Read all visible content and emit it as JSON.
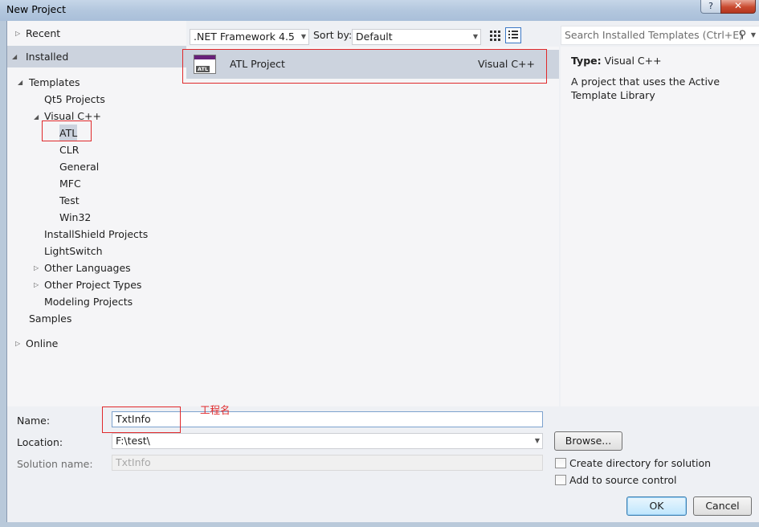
{
  "window": {
    "title": "New Project",
    "help_glyph": "?",
    "close_glyph": "✕"
  },
  "tree": {
    "recent": "Recent",
    "installed": "Installed",
    "templates": "Templates",
    "qt5": "Qt5 Projects",
    "visual_cpp": "Visual C++",
    "atl": "ATL",
    "clr": "CLR",
    "general": "General",
    "mfc": "MFC",
    "test": "Test",
    "win32": "Win32",
    "installshield": "InstallShield Projects",
    "lightswitch": "LightSwitch",
    "other_languages": "Other Languages",
    "other_project_types": "Other Project Types",
    "modeling": "Modeling Projects",
    "samples": "Samples",
    "online": "Online"
  },
  "toolbar": {
    "framework": ".NET Framework 4.5",
    "sort_label": "Sort by:",
    "sort_value": "Default"
  },
  "templates": [
    {
      "name": "ATL Project",
      "language": "Visual C++",
      "icon_label": "ATL"
    }
  ],
  "search": {
    "placeholder": "Search Installed Templates (Ctrl+E)"
  },
  "description": {
    "type_label": "Type:",
    "type_value": "Visual C++",
    "text": "A project that uses the Active Template Library"
  },
  "form": {
    "name_label": "Name:",
    "name_value": "TxtInfo",
    "location_label": "Location:",
    "location_value": "F:\\test\\",
    "solution_label": "Solution name:",
    "solution_value": "TxtInfo",
    "browse": "Browse...",
    "create_dir": "Create directory for solution",
    "add_source": "Add to source control",
    "ok": "OK",
    "cancel": "Cancel"
  },
  "annotation": {
    "project_name_note": "工程名"
  },
  "colors": {
    "annotation": "#e0292b",
    "selection": "#ccd3de",
    "atl_icon": "#68217a"
  }
}
